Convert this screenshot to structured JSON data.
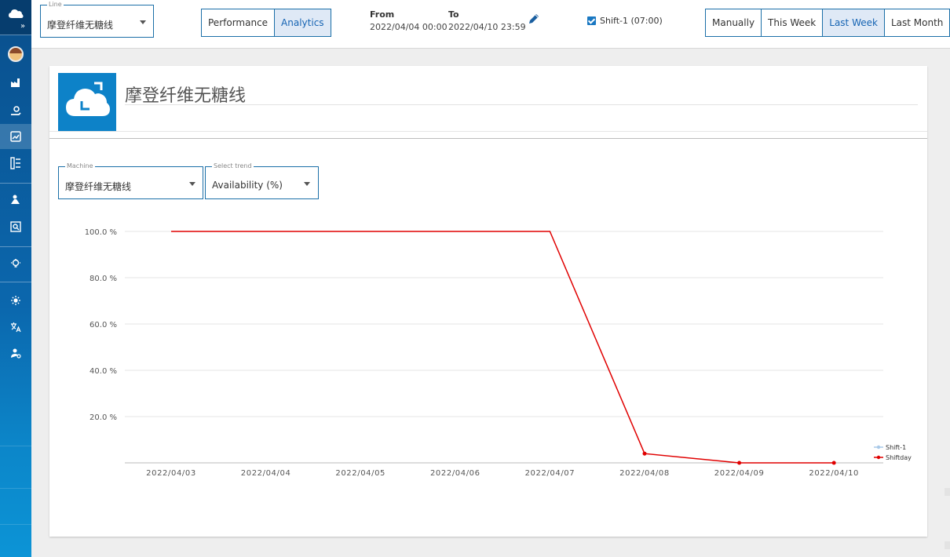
{
  "topbar": {
    "line_field": {
      "legend": "Line",
      "value": "摩登纤维无糖线"
    },
    "view_tabs": [
      {
        "label": "Performance",
        "active": false
      },
      {
        "label": "Analytics",
        "active": true
      }
    ],
    "from": {
      "label": "From",
      "value": "2022/04/04 00:00"
    },
    "to": {
      "label": "To",
      "value": "2022/04/10 23:59"
    },
    "shift_checkbox": {
      "label": "Shift-1 (07:00)",
      "checked": true
    },
    "period_tabs": [
      {
        "label": "Manually",
        "active": false
      },
      {
        "label": "This Week",
        "active": false
      },
      {
        "label": "Last Week",
        "active": true
      },
      {
        "label": "Last Month",
        "active": false
      }
    ]
  },
  "card": {
    "title": "摩登纤维无糖线",
    "machine_field": {
      "legend": "Machine",
      "value": "摩登纤维无糖线"
    },
    "trend_field": {
      "legend": "Select trend",
      "value": "Availability (%)"
    }
  },
  "colors": {
    "accent": "#1b6fa8",
    "active_tab_bg": "#dfe9f6",
    "series_shift1": "#a9c9e8",
    "series_shiftday": "#e00000"
  },
  "chart_data": {
    "type": "line",
    "title": "",
    "xlabel": "",
    "ylabel": "",
    "categories": [
      "2022/04/03",
      "2022/04/04",
      "2022/04/05",
      "2022/04/06",
      "2022/04/07",
      "2022/04/08",
      "2022/04/09",
      "2022/04/10"
    ],
    "y_ticks": [
      20,
      40,
      60,
      80,
      100
    ],
    "y_tick_labels": [
      "20.0 %",
      "40.0 %",
      "60.0 %",
      "80.0 %",
      "100.0 %"
    ],
    "ylim": [
      0,
      100
    ],
    "grid": true,
    "legend_position": "right",
    "series": [
      {
        "name": "Shift-1",
        "values": [],
        "color": "#a9c9e8"
      },
      {
        "name": "Shiftday",
        "color": "#e00000",
        "points": [
          {
            "x": "2022/04/03",
            "y": 100.0,
            "marker": false
          },
          {
            "x": "2022/04/07",
            "y": 100.0,
            "marker": false
          },
          {
            "x": "2022/04/08",
            "y": 4.0,
            "marker": true
          },
          {
            "x": "2022/04/09",
            "y": 0.0,
            "marker": true
          },
          {
            "x": "2022/04/10",
            "y": 0.0,
            "marker": true
          }
        ]
      }
    ]
  }
}
